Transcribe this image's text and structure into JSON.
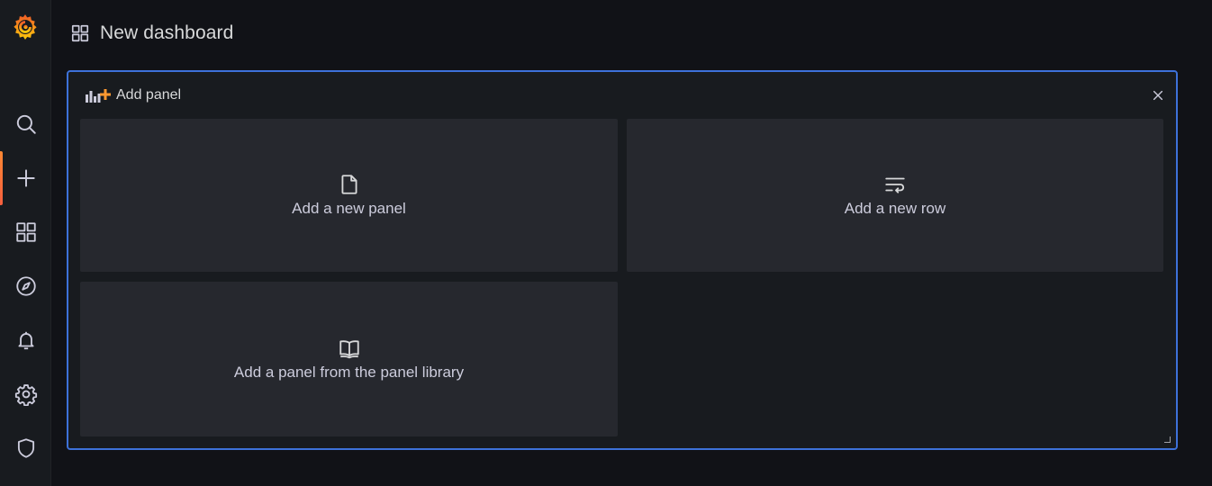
{
  "sidebar": {
    "logo": "grafana-logo",
    "items": [
      {
        "icon": "search-icon"
      },
      {
        "icon": "plus-icon",
        "active": true
      },
      {
        "icon": "dashboards-icon"
      },
      {
        "icon": "compass-icon"
      },
      {
        "icon": "bell-icon"
      },
      {
        "icon": "gear-icon"
      },
      {
        "icon": "shield-icon"
      }
    ]
  },
  "header": {
    "icon": "dashboards-icon",
    "title": "New dashboard"
  },
  "panel": {
    "title": "Add panel",
    "cards": {
      "new_panel": "Add a new panel",
      "new_row": "Add a new row",
      "library": "Add a panel from the panel library"
    }
  },
  "colors": {
    "accent": "#3d71d9",
    "brand": "#f46800",
    "background": "#111217",
    "card": "#26282e"
  }
}
